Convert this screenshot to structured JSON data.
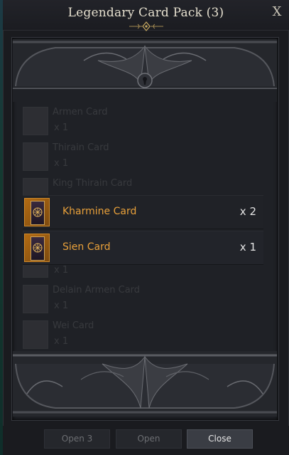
{
  "window": {
    "title": "Legendary Card Pack (3)",
    "close_glyph": "X"
  },
  "ghost_items": [
    {
      "name": "Armen Card",
      "qty": "x 1"
    },
    {
      "name": "Thirain Card",
      "qty": "x 1"
    },
    {
      "name": "King Thirain Card",
      "qty": ""
    },
    {
      "name": "",
      "qty": "x 1"
    },
    {
      "name": "Delain Armen Card",
      "qty": "x 1"
    },
    {
      "name": "Wei Card",
      "qty": "x 1"
    }
  ],
  "cards": [
    {
      "name": "Kharmine Card",
      "qty": "x 2",
      "icon": "card-icon"
    },
    {
      "name": "Sien Card",
      "qty": "x 1",
      "icon": "card-icon"
    }
  ],
  "buttons": {
    "open_3": "Open 3",
    "open": "Open",
    "close": "Close"
  },
  "colors": {
    "highlight_text": "#e8a03a",
    "card_frame": "#d08a2a"
  }
}
